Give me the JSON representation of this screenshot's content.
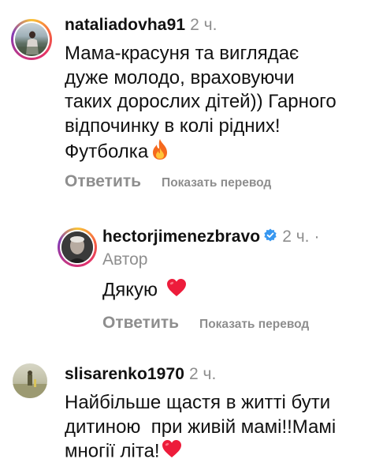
{
  "comments": [
    {
      "username": "nataliadovha91",
      "time": "2 ч.",
      "lines": [
        "Мама-красуня та виглядає",
        "дуже молодо, враховуючи",
        "таких дорослих дітей)) Гарного",
        "відпочинку в колі рідних!",
        "Футболка"
      ],
      "emoji": "fire-icon",
      "reply_label": "Ответить",
      "translate_label": "Показать перевод"
    },
    {
      "username": "hectorjimenezbravo",
      "time": "2 ч.",
      "dot": "·",
      "author_label": "Автор",
      "text": "Дякую",
      "emoji": "heart-icon",
      "reply_label": "Ответить",
      "translate_label": "Показать перевод"
    },
    {
      "username": "slisarenko1970",
      "time": "2 ч.",
      "lines": [
        "Найбільше щастя в житті бути",
        "дитиною  при живій мамі!!Мамі",
        "многії літа!"
      ],
      "emoji": "heart-icon"
    }
  ],
  "colors": {
    "text": "#111111",
    "muted": "#8e8e8e",
    "verified": "#3797f0",
    "heart": "#ed1c3b",
    "fire": "#f5691e"
  }
}
